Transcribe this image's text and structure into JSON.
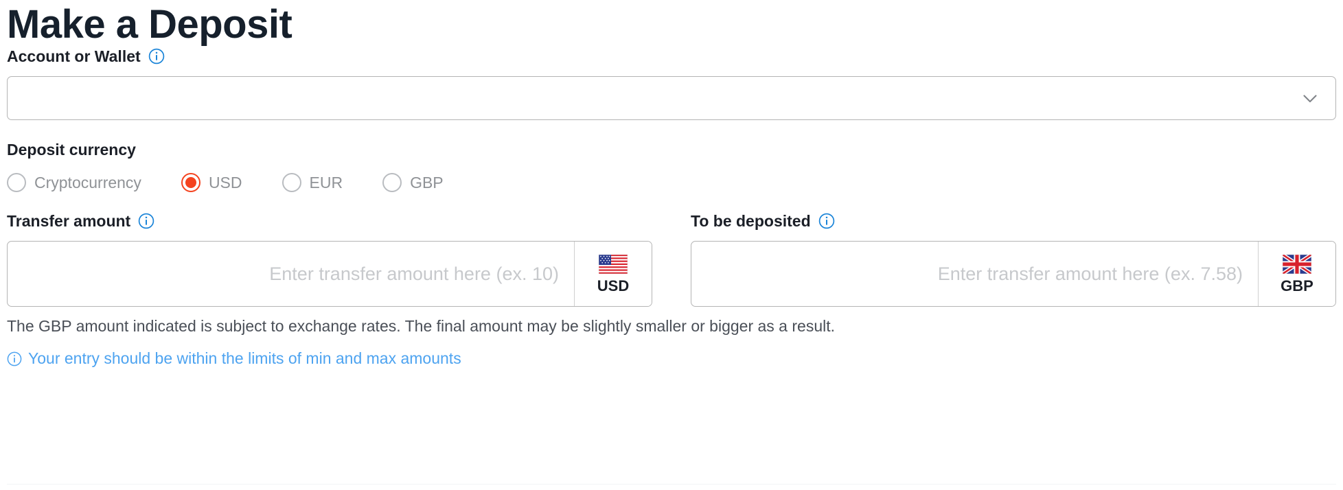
{
  "page": {
    "title": "Make a Deposit"
  },
  "account": {
    "label": "Account or Wallet",
    "info_icon": "info-icon",
    "value": "",
    "placeholder": "",
    "chevron_icon": "chevron-down-icon"
  },
  "deposit_currency": {
    "label": "Deposit currency",
    "options": [
      {
        "label": "Cryptocurrency",
        "selected": false
      },
      {
        "label": "USD",
        "selected": true
      },
      {
        "label": "EUR",
        "selected": false
      },
      {
        "label": "GBP",
        "selected": false
      }
    ],
    "selected_value": "USD"
  },
  "transfer_amount": {
    "label": "Transfer amount",
    "info_icon": "info-icon",
    "value": "",
    "placeholder": "Enter transfer amount here (ex. 10)",
    "currency_code": "USD",
    "flag_icon": "us-flag-icon"
  },
  "to_be_deposited": {
    "label": "To be deposited",
    "info_icon": "info-icon",
    "value": "",
    "placeholder": "Enter transfer amount here (ex. 7.58)",
    "currency_code": "GBP",
    "flag_icon": "gb-flag-icon"
  },
  "notes": {
    "exchange_rate_note": "The GBP amount indicated is subject to exchange rates. The final amount may be slightly smaller or bigger as a result.",
    "limits_hint": "Your entry should be within the limits of min and max amounts",
    "hint_icon": "info-icon"
  },
  "colors": {
    "accent_selected": "#f4431f",
    "info_blue": "#1a84d8",
    "hint_blue": "#4da3f0",
    "border_grey": "#b4b4b4",
    "placeholder_grey": "#c7c9cc",
    "label_grey": "#8f9296",
    "title_dark": "#16202c"
  }
}
